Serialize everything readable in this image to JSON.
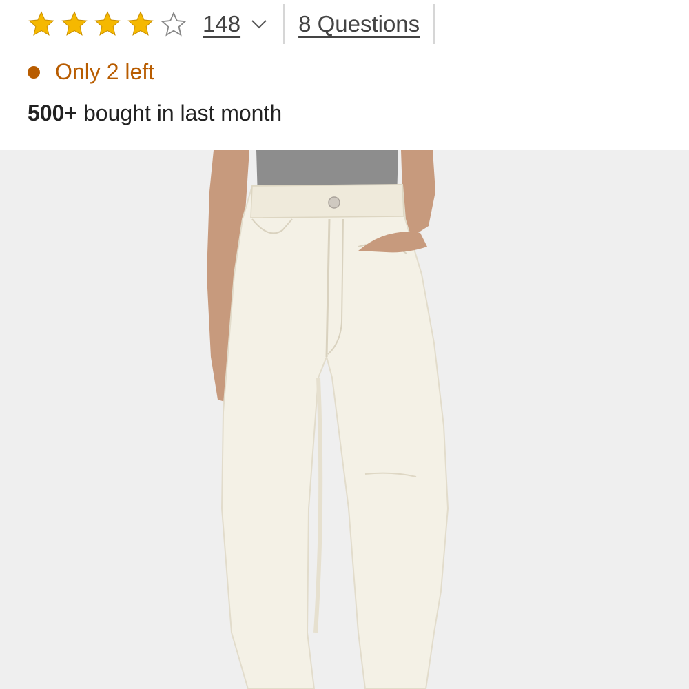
{
  "rating": {
    "stars_filled": 4,
    "stars_total": 5,
    "review_count": "148",
    "questions_label": "8 Questions",
    "star_color": "#f5b800",
    "star_empty_color": "#888888"
  },
  "stock": {
    "label": "Only 2 left",
    "color": "#b85c00"
  },
  "social_proof": {
    "count": "500+",
    "text": " bought in last month"
  },
  "product_image": {
    "background": "#efefef",
    "garment_color": "#f4f1e6"
  }
}
